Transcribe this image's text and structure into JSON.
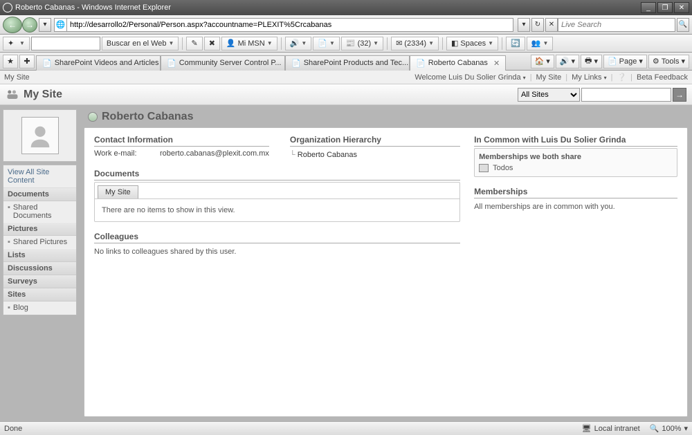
{
  "window": {
    "title": "Roberto Cabanas - Windows Internet Explorer",
    "minimize": "_",
    "maximize": "❐",
    "close": "✕"
  },
  "address": {
    "url": "http://desarrollo2/Personal/Person.aspx?accountname=PLEXIT%5Crcabanas",
    "refresh": "↻",
    "stop": "✕",
    "search_placeholder": "Live Search",
    "search_go": "🔍"
  },
  "toolbar": {
    "search_engine": "Buscar en el Web",
    "mimsn": "Mi MSN",
    "rss_count": "(32)",
    "mail_count": "(2334)",
    "spaces": "Spaces",
    "drop": "▼"
  },
  "tabs": {
    "items": [
      {
        "label": "SharePoint Videos and Articles"
      },
      {
        "label": "Community Server Control P..."
      },
      {
        "label": "SharePoint Products and Tec..."
      },
      {
        "label": "Roberto Cabanas"
      }
    ]
  },
  "ie_tools": {
    "page": "Page",
    "tools": "Tools",
    "drop": "▾"
  },
  "sp_top": {
    "left": "My Site",
    "welcome": "Welcome Luis Du Solier Grinda",
    "mysite": "My Site",
    "mylinks": "My Links",
    "beta": "Beta Feedback"
  },
  "mysite": {
    "title": "My Site",
    "scope": "All Sites",
    "go": "→"
  },
  "leftnav": {
    "view_all": "View All Site Content",
    "groups": [
      {
        "header": "Documents",
        "items": [
          "Shared Documents"
        ]
      },
      {
        "header": "Pictures",
        "items": [
          "Shared Pictures"
        ]
      },
      {
        "header": "Lists",
        "items": []
      },
      {
        "header": "Discussions",
        "items": []
      },
      {
        "header": "Surveys",
        "items": []
      },
      {
        "header": "Sites",
        "items": [
          "Blog"
        ]
      }
    ]
  },
  "profile": {
    "name": "Roberto Cabanas",
    "contact_hdr": "Contact Information",
    "work_email_label": "Work e-mail:",
    "work_email": "roberto.cabanas@plexit.com.mx",
    "org_hdr": "Organization Hierarchy",
    "org_node": "Roberto Cabanas",
    "docs_hdr": "Documents",
    "docs_tab": "My Site",
    "docs_empty": "There are no items to show in this view.",
    "colleagues_hdr": "Colleagues",
    "colleagues_empty": "No links to colleagues shared by this user."
  },
  "common": {
    "hdr": "In Common with Luis Du Solier Grinda",
    "shared_title": "Memberships we both share",
    "shared_item": "Todos",
    "memberships_hdr": "Memberships",
    "memberships_note": "All memberships are in common with you."
  },
  "status": {
    "done": "Done",
    "zone": "Local intranet",
    "zoom": "100%"
  }
}
